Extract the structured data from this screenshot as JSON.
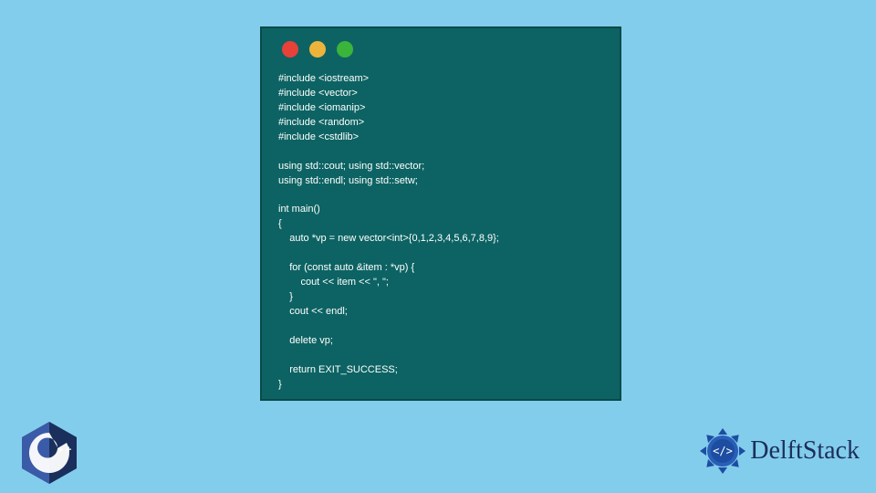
{
  "code_window": {
    "traffic_lights": {
      "red": "close-icon",
      "yellow": "minimize-icon",
      "green": "maximize-icon"
    },
    "code": "#include <iostream>\n#include <vector>\n#include <iomanip>\n#include <random>\n#include <cstdlib>\n\nusing std::cout; using std::vector;\nusing std::endl; using std::setw;\n\nint main()\n{\n    auto *vp = new vector<int>{0,1,2,3,4,5,6,7,8,9};\n\n    for (const auto &item : *vp) {\n        cout << item << \", \";\n    }\n    cout << endl;\n\n    delete vp;\n\n    return EXIT_SUCCESS;\n}"
  },
  "brand": {
    "name": "DelftStack"
  },
  "cpp_logo": {
    "label": "C++"
  }
}
